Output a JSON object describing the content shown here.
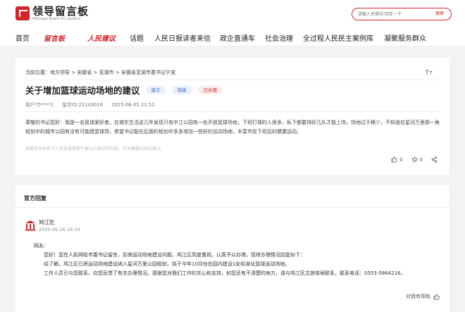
{
  "header": {
    "logo_title": "领导留言板",
    "logo_sub": "Message Board for Leaders",
    "search_placeholder": "请输入关键词 回车一下",
    "search_button": "搜索"
  },
  "nav": {
    "items": [
      "首页",
      "留言板",
      "人民建议",
      "话题",
      "人民日报读者来信",
      "政企直通车",
      "社会治理",
      "全过程人民民主案例库",
      "凝聚服务群众"
    ]
  },
  "message": {
    "breadcrumb": "当前位置：地方领导 > 安徽省 > 芜湖市 > 安徽省芜湖市委书记宁波",
    "font_toggle": "Tт",
    "title": "关于增加篮球运动场地的建议",
    "tags": [
      "建言",
      "城建",
      "已办理"
    ],
    "user": "用户75****1",
    "msg_id": "留言ID:23143016",
    "time": "2025-06-05 21:52",
    "body": "尊敬的书记您好：我是一名篮球爱好者，在城东生活这几年发现只有中江公园有一处开放篮球场地，下班打球的人很多，私下都要排好几队才能上场，场地过于稀少，不知道在星河万里那一角规划中的城市公园有没有可能建篮球场，希望书记能在后面的规划中多多增加一些好的运动场地，丰富市民下班后的健康运动。",
    "disclaimer": "该留言中含有个人信息或其他不便公开展示的内容，仅为摘要向网友展示。",
    "like_count": "0",
    "share_label": "0"
  },
  "reply": {
    "section_title": "官方回复",
    "dept": "鸠江区",
    "time": "2025-06-26 16:10",
    "greeting": "网友:",
    "lines": [
      "您好！您在人民网给市委书记留言，反映运动场地建设问题，鸠江区高度重视，认真予以办理，现将办理情况回复如下：",
      "经了解，鸠江区已将运动场地建设纳入星河万里公园规划，拟于今年10月份在园内建设1处标准化篮球运动场地。",
      "工作人员已与您联系，向您反馈了有关办理情况。感谢您对我们工作的关心和支持，如您还有不清楚的地方，请与鸠江区文旅体局联系，联系电话：0553-5864216。"
    ],
    "helpful_label": "对我有帮助"
  },
  "colors": {
    "brand_red": "#d3262c",
    "tag_blue": "#4a78c2"
  }
}
